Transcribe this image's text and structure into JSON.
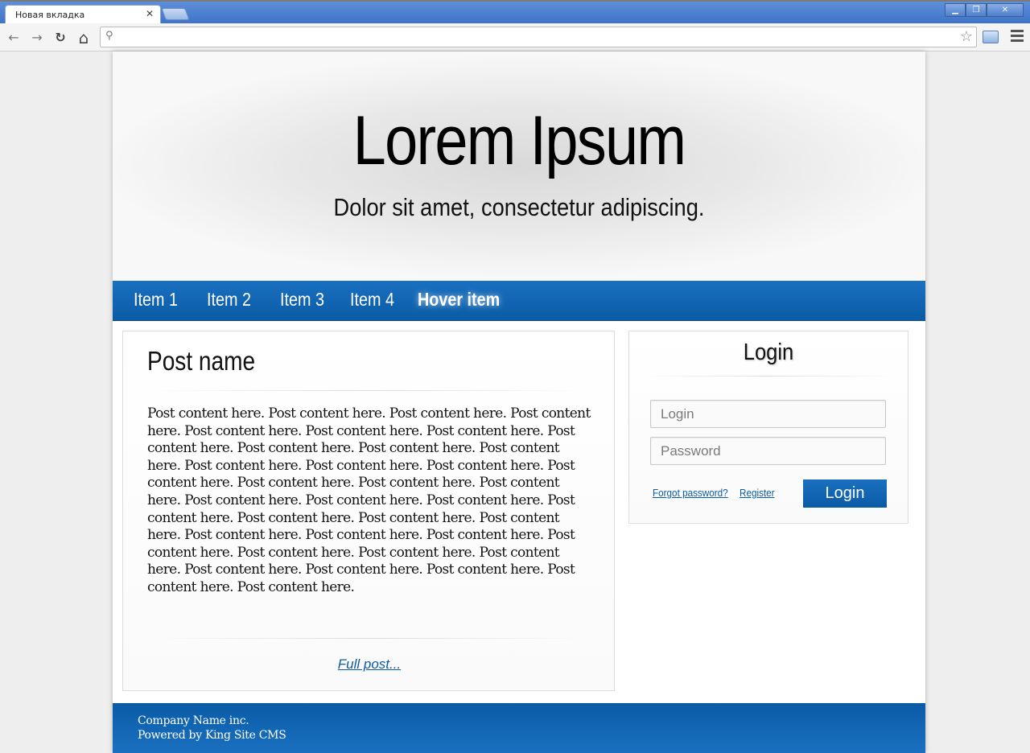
{
  "browser": {
    "tab_title": "Новая вкладка",
    "tab_close": "✕",
    "address_value": "",
    "window_minimize": "▁",
    "window_restore": "❐",
    "window_close": "✕",
    "nav_back": "←",
    "nav_forward": "→",
    "nav_reload": "↻",
    "nav_home": "⌂",
    "search_glyph": "⚲",
    "star_glyph": "☆"
  },
  "header": {
    "title": "Lorem Ipsum",
    "subtitle": "Dolor sit amet, consectetur adipiscing."
  },
  "nav": {
    "items": [
      {
        "label": "Item 1"
      },
      {
        "label": "Item 2"
      },
      {
        "label": "Item 3"
      },
      {
        "label": "Item 4"
      },
      {
        "label": "Hover item"
      }
    ]
  },
  "post": {
    "title": "Post name",
    "body": "Post content here. Post content here. Post content here. Post content here. Post content here. Post content here. Post content here. Post content here. Post content here. Post content here. Post content here. Post content here. Post content here. Post content here. Post content here. Post content here. Post content here. Post content here. Post content here. Post content here. Post content here. Post content here. Post content here. Post content here. Post content here. Post content here. Post content here. Post content here. Post content here. Post content here. Post content here. Post content here. Post content here. Post content here. Post content here. Post content here. Post content here.",
    "full_post_link": "Full post..."
  },
  "login": {
    "title": "Login",
    "login_placeholder": "Login",
    "password_placeholder": "Password",
    "forgot_link": "Forgot password?",
    "register_link": "Register",
    "submit_label": "Login"
  },
  "footer": {
    "company": "Company Name inc.",
    "powered": "Powered by King Site CMS"
  },
  "colors": {
    "accent": "#0a5ba5",
    "chrome": "#3f74c8"
  }
}
